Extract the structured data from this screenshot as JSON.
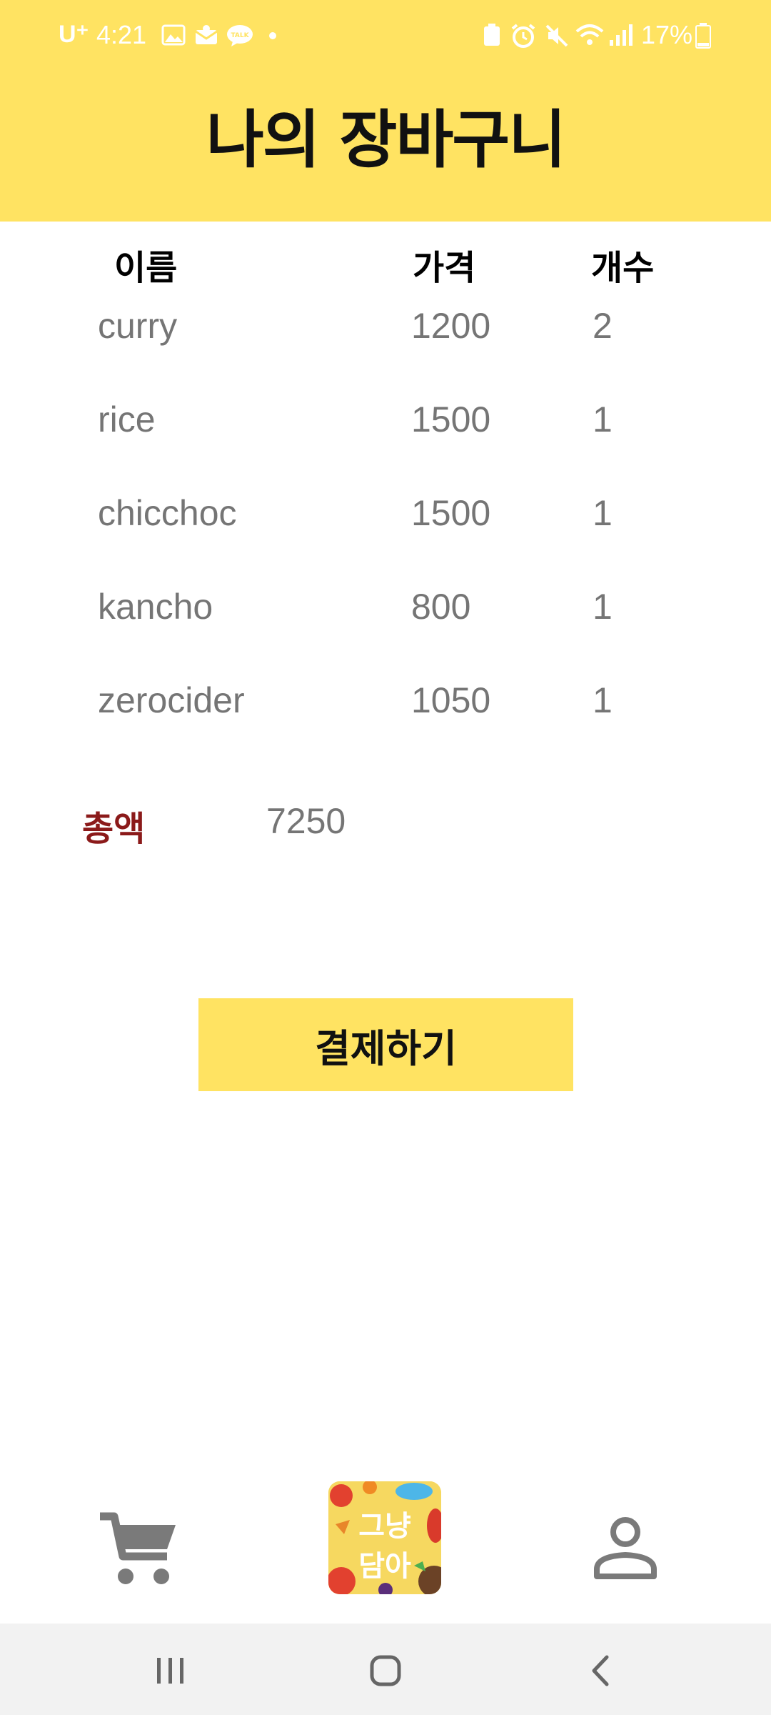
{
  "status_bar": {
    "carrier": "U⁺",
    "time": "4:21",
    "battery": "17%"
  },
  "header": {
    "title": "나의 장바구니"
  },
  "table": {
    "headers": {
      "name": "이름",
      "price": "가격",
      "count": "개수"
    },
    "rows": [
      {
        "name": "curry",
        "price": "1200",
        "count": "2"
      },
      {
        "name": "rice",
        "price": "1500",
        "count": "1"
      },
      {
        "name": "chicchoc",
        "price": "1500",
        "count": "1"
      },
      {
        "name": "kancho",
        "price": "800",
        "count": "1"
      },
      {
        "name": "zerocider",
        "price": "1050",
        "count": "1"
      }
    ]
  },
  "total": {
    "label": "총액",
    "value": "7250"
  },
  "pay_button": {
    "label": "결제하기"
  },
  "bottom_nav": {
    "cart_icon": "cart-icon",
    "logo_line1": "그냥",
    "logo_line2": "담아",
    "profile_icon": "person-icon"
  },
  "colors": {
    "accent_yellow": "#FFE362",
    "total_label_red": "#8B1A1A",
    "text_gray": "#757575"
  }
}
